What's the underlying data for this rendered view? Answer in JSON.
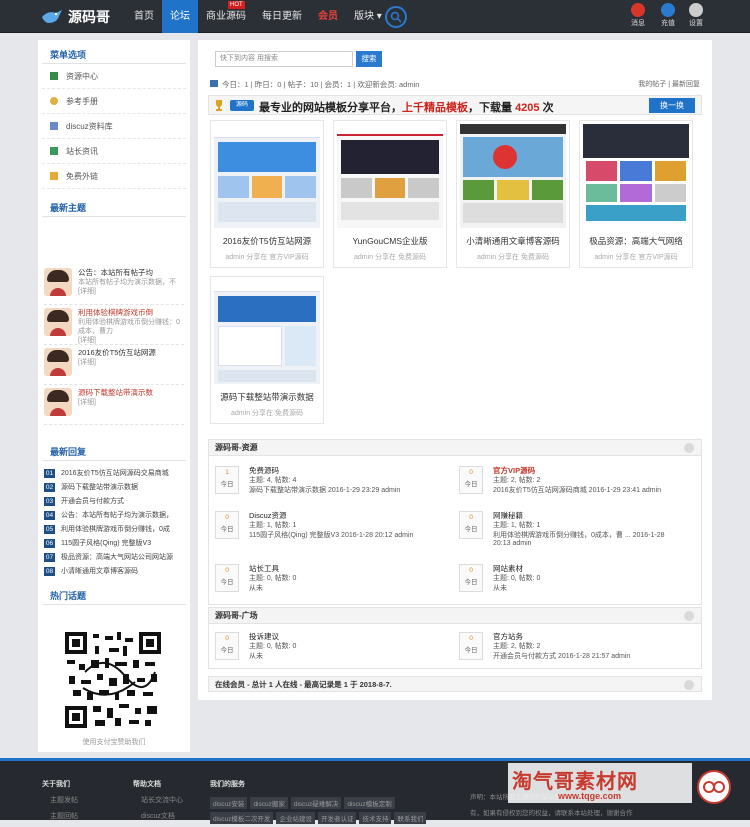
{
  "header": {
    "logo": "源码哥",
    "nav": [
      "首页",
      "论坛",
      "商业源码",
      "每日更新",
      "会员",
      "版块"
    ],
    "nav_hot_badge": "HOT",
    "right": [
      "消息",
      "充值",
      "设置"
    ]
  },
  "sidebar": {
    "menu_title": "菜单选项",
    "menu": [
      "资源中心",
      "参考手册",
      "discuz资料库",
      "站长资讯",
      "免费外链"
    ],
    "latest_title": "最新主题",
    "latest": [
      {
        "title": "公告：本站所有帖子均",
        "sub": "本站所有帖子均为演示数据，不",
        "more": "[详细]"
      },
      {
        "title": "利用体验棋牌游戏币倒",
        "sub": "利用体验棋牌游戏币倒分赚钱：0成本，曹力",
        "more": "[详细]"
      },
      {
        "title": "2016友价T5仿互站网源",
        "sub": "",
        "more": "[详细]"
      },
      {
        "title": "源码下载整站带演示数",
        "sub": "",
        "more": "[详细]"
      }
    ],
    "reply_title": "最新回复",
    "replies": [
      {
        "n": "01",
        "t": "2016友价T5仿互站网源码交易商城"
      },
      {
        "n": "02",
        "t": "源码下载整站带演示数据"
      },
      {
        "n": "03",
        "t": "开通会员与付款方式"
      },
      {
        "n": "04",
        "t": "公告：本站所有帖子均为演示数据，"
      },
      {
        "n": "05",
        "t": "利用体验棋牌游戏币倒分赚钱，0成"
      },
      {
        "n": "06",
        "t": "115圆子风格(Qing) 完整版V3"
      },
      {
        "n": "07",
        "t": "极品资源：高端大气网站公司网站源"
      },
      {
        "n": "08",
        "t": "小清晰通用文章博客源码"
      }
    ],
    "hot_title": "热门话题",
    "qr_caption": "使用支付宝赞助我们"
  },
  "main": {
    "search_placeholder": "快下到内容 用搜索",
    "search_btn": "搜索",
    "stats": "今日：1 | 昨日：0 | 帖子：10 | 会员：1 | 欢迎新会员: admin",
    "stats_right": "我的帖子 | 最新回复",
    "banner": {
      "pill": "源码",
      "pre": "最专业的网站模板分享平台，",
      "red": "上千精品模板",
      "mid": "，下载量",
      "count": "4205",
      "post": "次",
      "btn": "换一换"
    },
    "cards": [
      {
        "title": "2016友价T5仿互站网源",
        "meta": "admin 分享在 官方VIP源码"
      },
      {
        "title": "YunGouCMS企业版",
        "meta": "admin 分享在 免费源码"
      },
      {
        "title": "小清晰通用文章博客源码",
        "meta": "admin 分享在 免费源码"
      },
      {
        "title": "极品资源：高端大气网络",
        "meta": "admin 分享在 官方VIP源码"
      },
      {
        "title": "源码下载整站带演示数据",
        "meta": "admin 分享在 免费源码"
      }
    ],
    "section1": {
      "title": "源码哥-资源",
      "forums": [
        {
          "name": "免费源码",
          "today_n": "1",
          "l1": "主题: 4, 帖数: 4",
          "l2": "源码下载整站带演示数据 2016-1-29 23:29 admin"
        },
        {
          "name": "官方VIP源码",
          "today_n": "0",
          "l1": "主题: 2, 帖数: 2",
          "l2": "2016友价T5仿互站网源码商城 2016-1-29 23:41 admin"
        },
        {
          "name": "Discuz资源",
          "today_n": "0",
          "l1": "主题: 1, 帖数: 1",
          "l2": "115圆子风格(Qing) 完整版V3 2016-1-28 20:12 admin"
        },
        {
          "name": "网赚秘籍",
          "today_n": "0",
          "l1": "主题: 1, 帖数: 1",
          "l2": "利用体验棋牌游戏币倒分赚钱，0成本，曹 ... 2016-1-28",
          "l3": "20:13 admin"
        },
        {
          "name": "站长工具",
          "today_n": "0",
          "l1": "主题: 0, 帖数: 0",
          "l2": "从未"
        },
        {
          "name": "网站素材",
          "today_n": "0",
          "l1": "主题: 0, 帖数: 0",
          "l2": "从未"
        }
      ]
    },
    "section2": {
      "title": "源码哥-广场",
      "forums": [
        {
          "name": "投诉建议",
          "today_n": "0",
          "l1": "主题: 0, 帖数: 0",
          "l2": "从未"
        },
        {
          "name": "官方站务",
          "today_n": "0",
          "l1": "主题: 2, 帖数: 2",
          "l2": "开通会员与付款方式 2016-1-28 21:57 admin"
        }
      ]
    },
    "today_label": "今日",
    "online": "在线会员 - 总计 1 人在线 - 最高记录是 1 于 2018-8-7."
  },
  "footer": {
    "col1": {
      "h": "关于我们",
      "items": [
        "主题发帖",
        "主题回帖"
      ]
    },
    "col2": {
      "h": "帮助文档",
      "items": [
        "站长交流中心",
        "discuz文档"
      ]
    },
    "col3": {
      "h": "我们的服务"
    },
    "tags": [
      "discuz安装",
      "discuz搬家",
      "discuz疑难解决",
      "discuz模板定制",
      "discuz模板二次开发",
      "企业站建设",
      "开发者认证",
      "技术支持",
      "联系我们"
    ],
    "right": "声明：本站所有主题均为演示数据，",
    "right2": "有，如果有侵权到您的权益，请联系本站处理，谢谢合作"
  },
  "watermark": {
    "big": "淘气哥素材网",
    "url": "www.tqge.com"
  },
  "colors": {
    "accent": "#1f73c9",
    "topbar": "#2b2f36",
    "hot": "#d0231b"
  }
}
